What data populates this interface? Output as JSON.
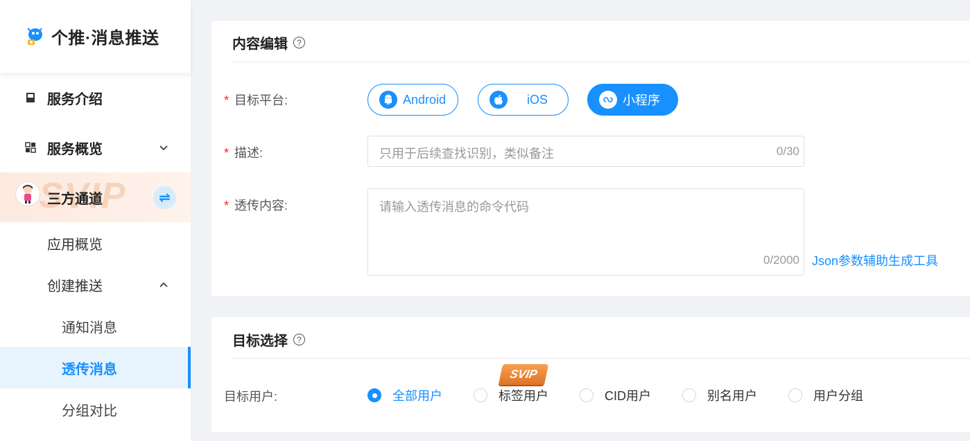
{
  "brand": {
    "title": "个推·消息推送"
  },
  "sidebar": {
    "service_intro": "服务介绍",
    "service_overview": "服务概览",
    "third_party": "三方通道",
    "svip_watermark": "SVIP",
    "app_overview": "应用概览",
    "create_push": "创建推送",
    "notify_message": "通知消息",
    "passthrough_message": "透传消息",
    "group_compare": "分组对比"
  },
  "content_edit": {
    "title": "内容编辑",
    "help": "?",
    "platform_label": "目标平台:",
    "platforms": [
      {
        "label": "Android",
        "active": false
      },
      {
        "label": "iOS",
        "active": false
      },
      {
        "label": "小程序",
        "active": true
      }
    ],
    "desc_label": "描述:",
    "desc_placeholder": "只用于后续查找识别，类似备注",
    "desc_count": "0/30",
    "payload_label": "透传内容:",
    "payload_placeholder": "请输入透传消息的命令代码",
    "payload_count": "0/2000",
    "json_tool_link": "Json参数辅助生成工具",
    "required_mark": "*"
  },
  "target_select": {
    "title": "目标选择",
    "help": "?",
    "users_label": "目标用户:",
    "svip_badge": "SVIP",
    "options": [
      {
        "label": "全部用户",
        "checked": true
      },
      {
        "label": "标签用户",
        "checked": false
      },
      {
        "label": "CID用户",
        "checked": false
      },
      {
        "label": "别名用户",
        "checked": false
      },
      {
        "label": "用户分组",
        "checked": false
      }
    ]
  },
  "colors": {
    "accent": "#1890ff",
    "required": "#f5222d",
    "svip": "#e88a3a"
  }
}
